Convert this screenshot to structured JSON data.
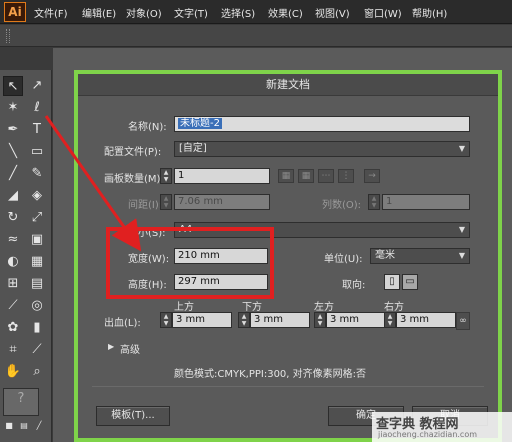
{
  "app": {
    "logo": "Ai"
  },
  "menu": [
    "文件(F)",
    "编辑(E)",
    "对象(O)",
    "文字(T)",
    "选择(S)",
    "效果(C)",
    "视图(V)",
    "窗口(W)",
    "帮助(H)"
  ],
  "dialog": {
    "title": "新建文档",
    "name_label": "名称(N):",
    "name_value": "未标题-2",
    "profile_label": "配置文件(P):",
    "profile_value": "[自定]",
    "artboards_label": "画板数量(M):",
    "artboards_value": "1",
    "spacing_label": "间距(I):",
    "spacing_value": "7.06 mm",
    "columns_label": "列数(O):",
    "columns_value": "1",
    "size_label": "大小(S):",
    "size_value": "A4",
    "width_label": "宽度(W):",
    "width_value": "210 mm",
    "height_label": "高度(H):",
    "height_value": "297 mm",
    "units_label": "单位(U):",
    "units_value": "毫米",
    "orientation_label": "取向:",
    "bleed_label": "出血(L):",
    "bleed_top_label": "上方",
    "bleed_bottom_label": "下方",
    "bleed_left_label": "左方",
    "bleed_right_label": "右方",
    "bleed_top": "3 mm",
    "bleed_bottom": "3 mm",
    "bleed_left": "3 mm",
    "bleed_right": "3 mm",
    "advanced_label": "高级",
    "info_text": "颜色模式:CMYK,PPI:300, 对齐像素网格:否",
    "templates_button": "模板(T)...",
    "ok_button": "确定",
    "cancel_button": "取消"
  },
  "watermark": {
    "main": "查字典 教程网",
    "sub": "jiaocheng.chazidian.com"
  },
  "colors": {
    "highlight_border": "#7fd34a",
    "annotation": "#e02020"
  }
}
